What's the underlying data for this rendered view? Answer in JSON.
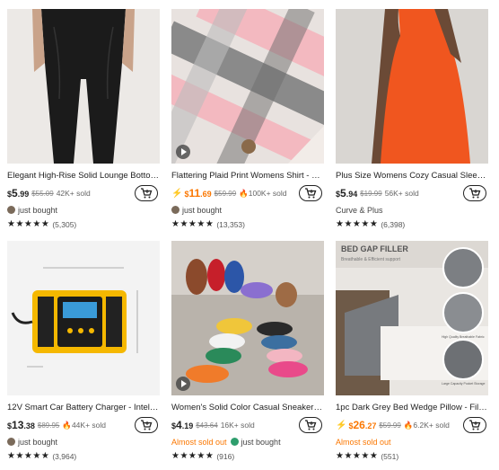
{
  "products": [
    {
      "title": "Elegant High-Rise Solid Lounge Bottom...",
      "price_symbol": "$",
      "price_int": "5",
      "price_dec": ".99",
      "price_highlight": false,
      "old_price": "$55.09",
      "sold": "42K+ sold",
      "sold_hot": false,
      "info": "just bought",
      "info_type": "buyer",
      "stars": "★★★★★",
      "reviews": "(5,305)",
      "has_video": false,
      "image": "leggings"
    },
    {
      "title": "Flattering Plaid Print Womens Shirt - Fa...",
      "price_symbol": "$",
      "price_int": "11",
      "price_dec": ".69",
      "price_highlight": true,
      "old_price": "$59.99",
      "sold": "100K+ sold",
      "sold_hot": true,
      "info": "just bought",
      "info_type": "buyer",
      "stars": "★★★★★",
      "reviews": "(13,353)",
      "has_video": true,
      "image": "plaid"
    },
    {
      "title": "Plus Size Womens Cozy Casual Sleep Dr...",
      "price_symbol": "$",
      "price_int": "5",
      "price_dec": ".94",
      "price_highlight": false,
      "old_price": "$19.99",
      "sold": "56K+ sold",
      "sold_hot": false,
      "info": "Curve & Plus",
      "info_type": "text",
      "stars": "★★★★★",
      "reviews": "(6,398)",
      "has_video": false,
      "image": "dress"
    },
    {
      "title": "12V Smart Car Battery Charger - Intellig...",
      "price_symbol": "$",
      "price_int": "13",
      "price_dec": ".38",
      "price_highlight": false,
      "old_price": "$89.95",
      "sold": "44K+ sold",
      "sold_hot": true,
      "info": "just bought",
      "info_type": "buyer",
      "stars": "★★★★★",
      "reviews": "(3,964)",
      "has_video": false,
      "image": "charger"
    },
    {
      "title": "Women's Solid Color Casual Sneakers, ...",
      "price_symbol": "$",
      "price_int": "4",
      "price_dec": ".19",
      "price_highlight": false,
      "old_price": "$43.64",
      "sold": "16K+ sold",
      "sold_hot": false,
      "almost": "Almost sold out",
      "info": "just bought",
      "info_type": "buyer-green",
      "stars": "★★★★★",
      "reviews": "(916)",
      "has_video": true,
      "image": "shoes"
    },
    {
      "title": "1pc Dark Grey Bed Wedge Pillow - Fills ...",
      "price_symbol": "$",
      "price_int": "26",
      "price_dec": ".27",
      "price_highlight": true,
      "old_price": "$59.99",
      "sold": "6.2K+ sold",
      "sold_hot": true,
      "almost": "Almost sold out",
      "info": "",
      "info_type": "none",
      "stars": "★★★★★",
      "reviews": "(551)",
      "has_video": false,
      "image": "pillow",
      "image_text": {
        "headline": "BED GAP FILLER",
        "sub": "Breathable & Efficient support",
        "cap1": "High Quality Breathable Fabric",
        "cap2": "Large Capacity Pocket Storage"
      }
    }
  ],
  "colors": {
    "accent": "#fb7701",
    "text": "#222222"
  }
}
